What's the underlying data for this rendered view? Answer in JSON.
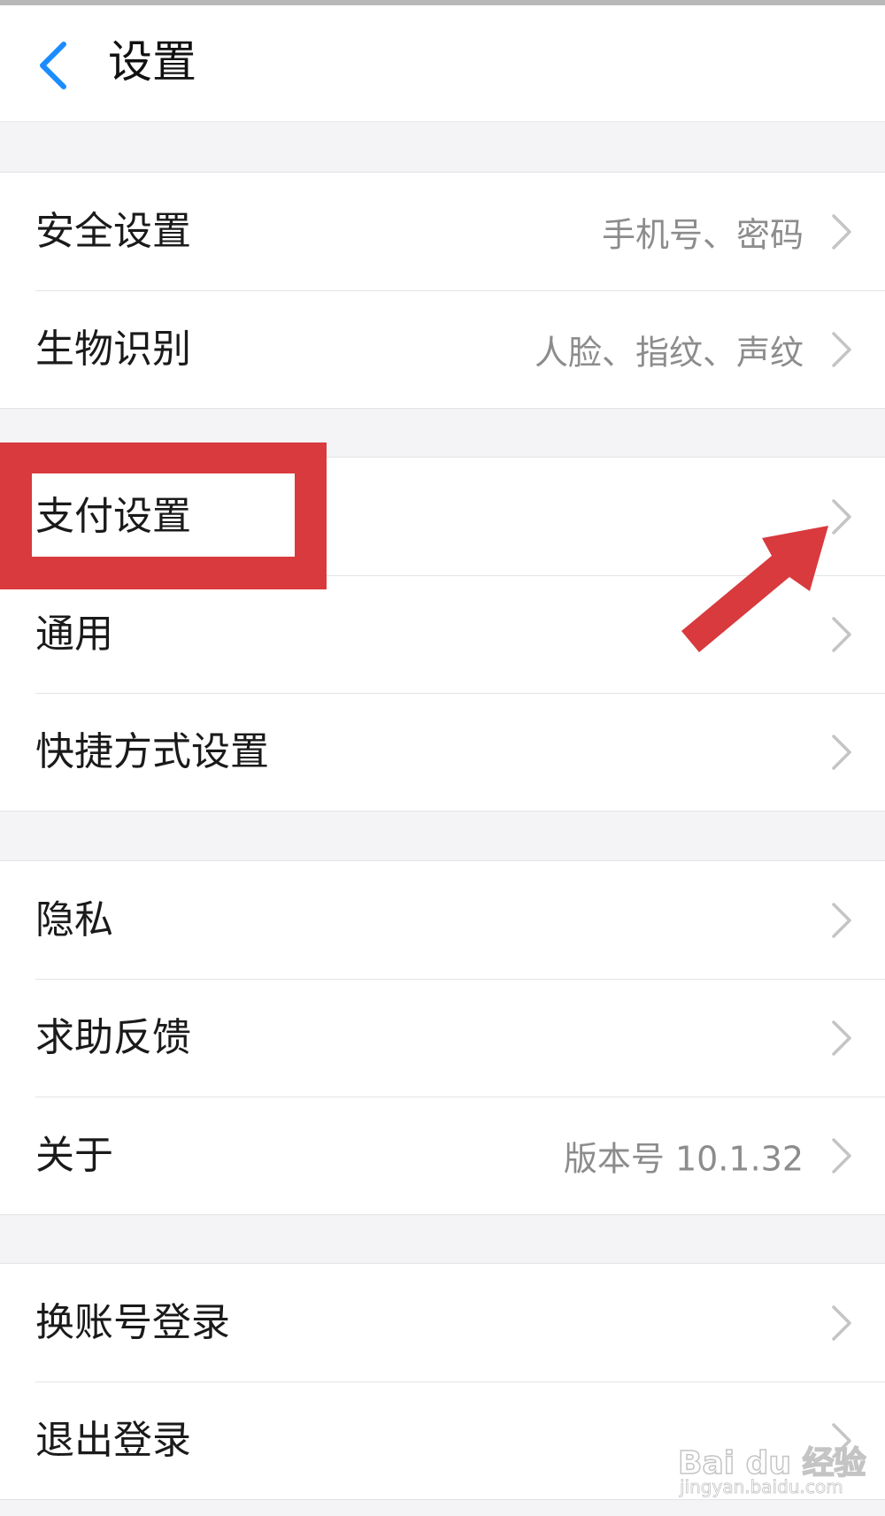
{
  "header": {
    "title": "设置",
    "back_icon": "chevron-left-icon"
  },
  "colors": {
    "accent": "#1a8cff",
    "highlight": "#d83a3d",
    "value_text": "#8c8c8c"
  },
  "groups": [
    {
      "items": [
        {
          "label": "安全设置",
          "value": "手机号、密码"
        },
        {
          "label": "生物识别",
          "value": "人脸、指纹、声纹"
        }
      ]
    },
    {
      "items": [
        {
          "label": "支付设置"
        },
        {
          "label": "通用"
        },
        {
          "label": "快捷方式设置"
        }
      ]
    },
    {
      "items": [
        {
          "label": "隐私"
        },
        {
          "label": "求助反馈"
        },
        {
          "label": "关于",
          "value": "版本号 10.1.32"
        }
      ]
    },
    {
      "items": [
        {
          "label": "换账号登录"
        },
        {
          "label": "退出登录"
        }
      ]
    }
  ],
  "annotation": {
    "highlighted_item": "支付设置",
    "arrow_color": "#d83a3d"
  },
  "watermark": {
    "main": "Bai du 经验",
    "sub": "jingyan.baidu.com"
  }
}
